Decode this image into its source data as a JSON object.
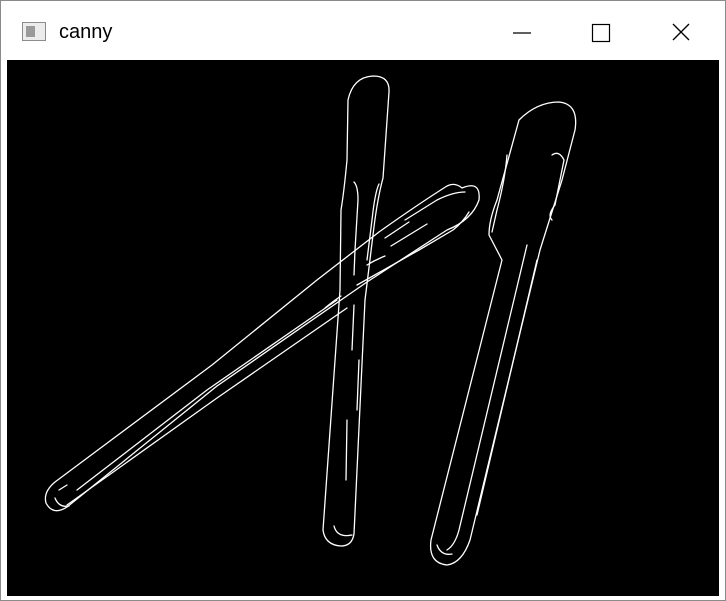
{
  "window": {
    "title": "canny",
    "icon": "app-window-icon",
    "controls": [
      "minimize-icon",
      "maximize-icon",
      "close-icon"
    ]
  },
  "image": {
    "description_colors": {
      "background": "#000000",
      "edges": "#ffffff"
    }
  }
}
